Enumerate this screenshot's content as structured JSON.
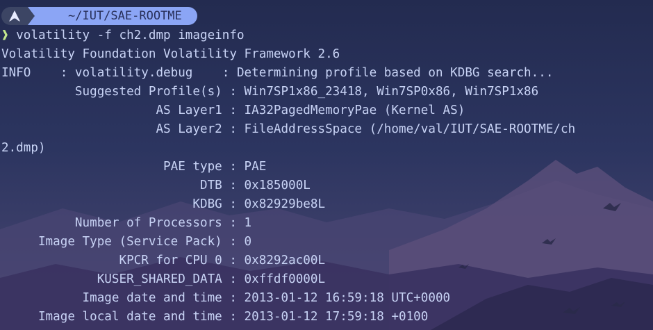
{
  "prompt": {
    "icon": "arch-linux-icon",
    "path": "~/IUT/SAE-ROOTME",
    "char": "❱",
    "command": " volatility -f ch2.dmp imageinfo"
  },
  "colors": {
    "prompt_icon_bg": "#3c4564",
    "prompt_path_bg": "#8ba5f5",
    "prompt_char": "#c3e88d",
    "text": "#c8d3f5",
    "background": "#232d54"
  },
  "output": [
    "Volatility Foundation Volatility Framework 2.6",
    "INFO    : volatility.debug    : Determining profile based on KDBG search...",
    "          Suggested Profile(s) : Win7SP1x86_23418, Win7SP0x86, Win7SP1x86",
    "                     AS Layer1 : IA32PagedMemoryPae (Kernel AS)",
    "                     AS Layer2 : FileAddressSpace (/home/val/IUT/SAE-ROOTME/ch",
    "2.dmp)",
    "                      PAE type : PAE",
    "                           DTB : 0x185000L",
    "                          KDBG : 0x82929be8L",
    "          Number of Processors : 1",
    "     Image Type (Service Pack) : 0",
    "                KPCR for CPU 0 : 0x8292ac00L",
    "             KUSER_SHARED_DATA : 0xffdf0000L",
    "           Image date and time : 2013-01-12 16:59:18 UTC+0000",
    "     Image local date and time : 2013-01-12 17:59:18 +0100"
  ]
}
